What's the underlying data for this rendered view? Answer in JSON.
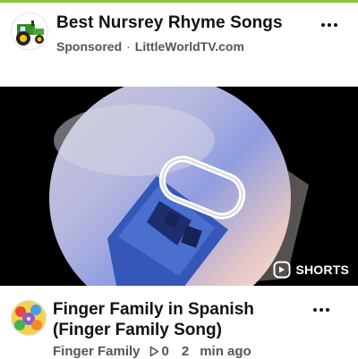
{
  "ad": {
    "title": "Best Nursrey Rhyme Songs",
    "sponsored_label": "Sponsored",
    "separator": "·",
    "domain": "LittleWorldTV.com",
    "avatar_icon": "tractor-icon"
  },
  "video": {
    "badge_label": "SHORTS",
    "badge_icon": "shorts-icon",
    "thumbnail_icon": "floppy-disk-icon"
  },
  "item": {
    "title": "Finger Family in Spanish (Finger Family Song)",
    "channel": "Finger Family",
    "views": "0",
    "views_icon": "play-outline-icon",
    "age_count": "2",
    "age_unit": "min ago"
  },
  "colors": {
    "accent_line": "#8cc63f",
    "text_primary": "#111111",
    "text_secondary": "#555555",
    "video_background": "#000000"
  }
}
